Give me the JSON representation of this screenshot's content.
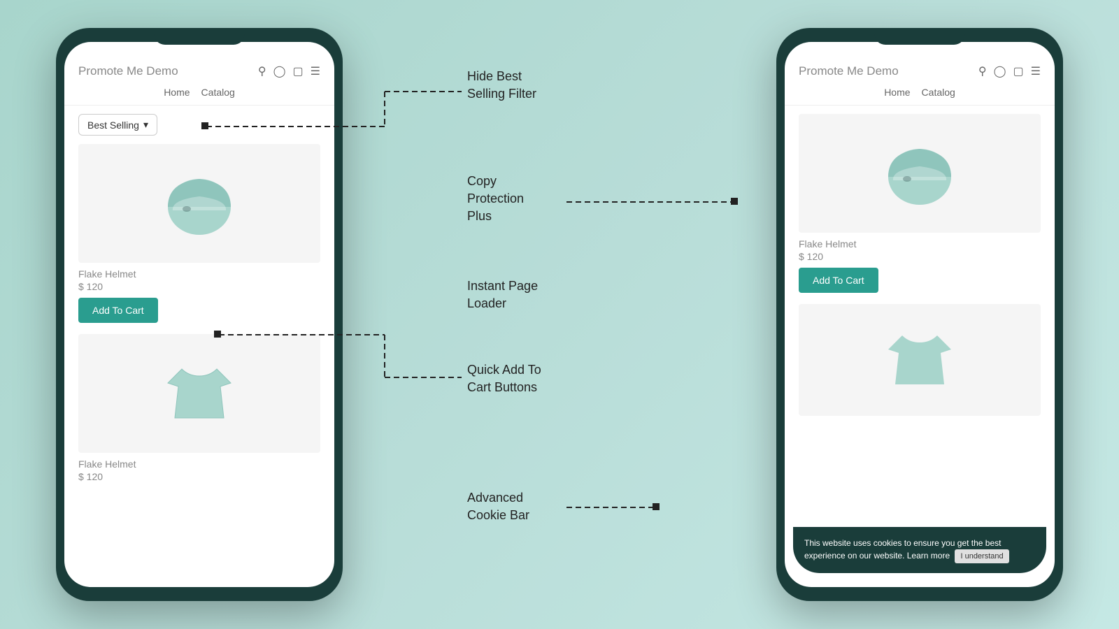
{
  "app": {
    "title": "Promote Me Demo"
  },
  "phones": {
    "left": {
      "store_name": "Promote Me Demo",
      "nav": [
        "Home",
        "Catalog"
      ],
      "filter": {
        "label": "Best Selling",
        "arrow": "▾"
      },
      "products": [
        {
          "name": "Flake Helmet",
          "price": "$ 120",
          "has_cart_btn": true
        },
        {
          "name": "Flake Helmet",
          "price": "$ 120",
          "has_cart_btn": false
        }
      ],
      "add_to_cart": "Add To Cart"
    },
    "right": {
      "store_name": "Promote Me Demo",
      "nav": [
        "Home",
        "Catalog"
      ],
      "products": [
        {
          "name": "Flake Helmet",
          "price": "$ 120",
          "has_cart_btn": true
        },
        {
          "name": "",
          "price": "",
          "has_cart_btn": false
        }
      ],
      "add_to_cart": "Add To Cart",
      "cookie_bar": {
        "text": "This website uses cookies to ensure you get the best experience on our website. Learn more",
        "btn": "I understand"
      }
    }
  },
  "labels": [
    {
      "id": "hide-best-selling",
      "text": "Hide Best\nSelling Filter"
    },
    {
      "id": "copy-protection",
      "text": "Copy\nProtection\nPlus"
    },
    {
      "id": "instant-page",
      "text": "Instant Page\nLoader"
    },
    {
      "id": "quick-add",
      "text": "Quick Add To\nCart Buttons"
    },
    {
      "id": "advanced-cookie",
      "text": "Advanced\nCookie Bar"
    }
  ],
  "icons": {
    "search": "🔍",
    "user": "👤",
    "cart": "🛍",
    "menu": "☰"
  },
  "colors": {
    "teal": "#2a9d8f",
    "dark": "#1a3d3a",
    "bg_start": "#a8d5cc",
    "bg_end": "#c5e8e4"
  }
}
